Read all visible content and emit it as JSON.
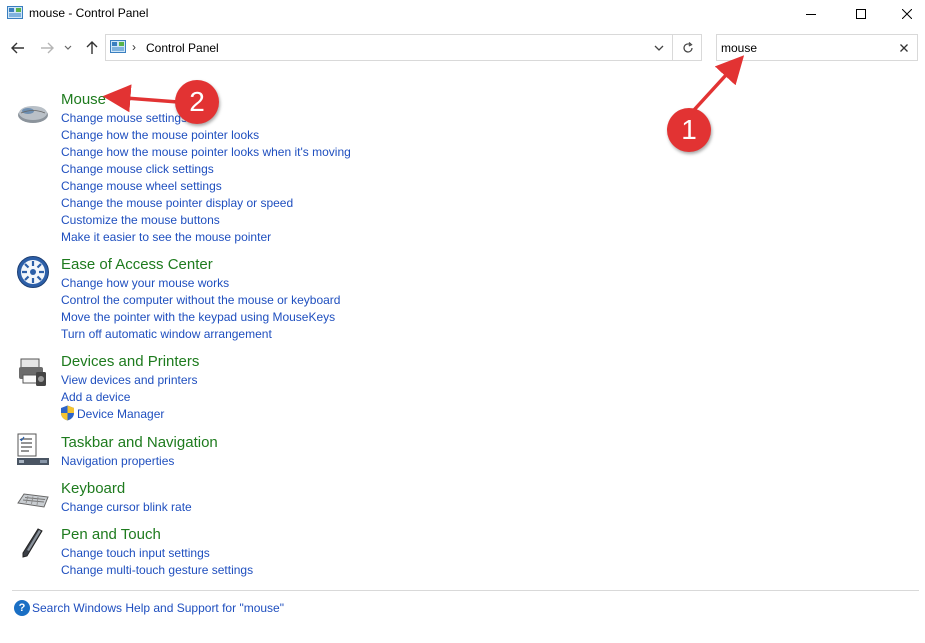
{
  "window": {
    "title": "mouse - Control Panel",
    "controls": {
      "minimize": "minimize-icon",
      "maximize": "maximize-icon",
      "close": "close-icon"
    }
  },
  "nav": {
    "back_icon": "arrow-left-icon",
    "forward_icon": "arrow-right-icon",
    "recent_icon": "chevron-down-icon",
    "up_icon": "arrow-up-icon",
    "breadcrumb_separator": "›",
    "breadcrumb": "Control Panel",
    "dropdown_icon": "chevron-down-icon",
    "refresh_icon": "refresh-icon"
  },
  "search": {
    "value": "mouse",
    "clear_icon": "close-icon"
  },
  "groups": [
    {
      "title": "Mouse",
      "icon": "mouse-icon",
      "links": [
        "Change mouse settings",
        "Change how the mouse pointer looks",
        "Change how the mouse pointer looks when it's moving",
        "Change mouse click settings",
        "Change mouse wheel settings",
        "Change the mouse pointer display or speed",
        "Customize the mouse buttons",
        "Make it easier to see the mouse pointer"
      ]
    },
    {
      "title": "Ease of Access Center",
      "icon": "ease-of-access-icon",
      "links": [
        "Change how your mouse works",
        "Control the computer without the mouse or keyboard",
        "Move the pointer with the keypad using MouseKeys",
        "Turn off automatic window arrangement"
      ]
    },
    {
      "title": "Devices and Printers",
      "icon": "printer-icon",
      "links": [
        "View devices and printers",
        "Add a device",
        "Device Manager"
      ]
    },
    {
      "title": "Taskbar and Navigation",
      "icon": "taskbar-icon",
      "links": [
        "Navigation properties"
      ]
    },
    {
      "title": "Keyboard",
      "icon": "keyboard-icon",
      "links": [
        "Change cursor blink rate"
      ]
    },
    {
      "title": "Pen and Touch",
      "icon": "pen-icon",
      "links": [
        "Change touch input settings",
        "Change multi-touch gesture settings"
      ]
    }
  ],
  "help": {
    "icon_glyph": "?",
    "text": "Search Windows Help and Support for \"mouse\""
  },
  "annotations": {
    "badge1": "1",
    "badge2": "2",
    "color": "#e23333"
  },
  "colors": {
    "title_green": "#1e7b1e",
    "link_blue": "#1f4fbf"
  }
}
